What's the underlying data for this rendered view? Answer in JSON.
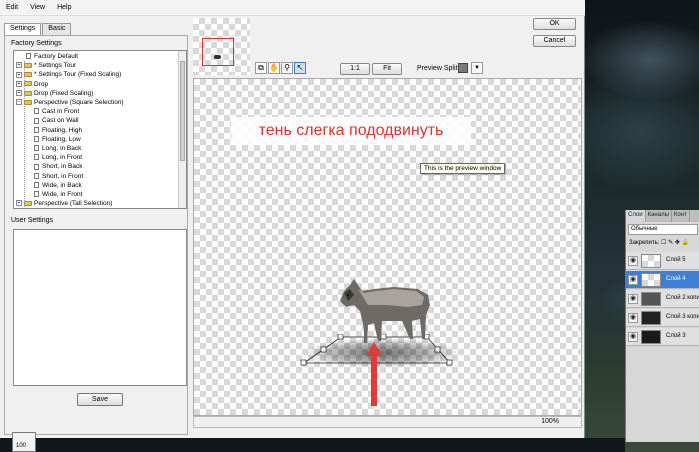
{
  "menu": [
    "Edit",
    "View",
    "Help"
  ],
  "tabs": [
    {
      "label": "Settings",
      "active": true
    },
    {
      "label": "Basic",
      "active": false
    }
  ],
  "factory_settings_label": "Factory Settings",
  "tree_items": [
    {
      "label": "Factory Default",
      "kind": "doc",
      "level": 1
    },
    {
      "label": "* Settings Tour",
      "kind": "folder",
      "level": 0,
      "expander": "+"
    },
    {
      "label": "* Settings Tour (Fixed Scaling)",
      "kind": "folder",
      "level": 0,
      "expander": "+"
    },
    {
      "label": "Drop",
      "kind": "folder",
      "level": 0,
      "expander": "+"
    },
    {
      "label": "Drop (Fixed Scaling)",
      "kind": "folder",
      "level": 0,
      "expander": "+"
    },
    {
      "label": "Perspective (Square Selection)",
      "kind": "folder",
      "level": 0,
      "expander": "−"
    },
    {
      "label": "Cast in Front",
      "kind": "doc",
      "level": 2
    },
    {
      "label": "Cast on Wall",
      "kind": "doc",
      "level": 2
    },
    {
      "label": "Floating, High",
      "kind": "doc",
      "level": 2
    },
    {
      "label": "Floating, Low",
      "kind": "doc",
      "level": 2
    },
    {
      "label": "Long, in Back",
      "kind": "doc",
      "level": 2
    },
    {
      "label": "Long, in Front",
      "kind": "doc",
      "level": 2
    },
    {
      "label": "Short, in Back",
      "kind": "doc",
      "level": 2
    },
    {
      "label": "Short, in Front",
      "kind": "doc",
      "level": 2
    },
    {
      "label": "Wide, in Back",
      "kind": "doc",
      "level": 2
    },
    {
      "label": "Wide, in Front",
      "kind": "doc",
      "level": 2
    },
    {
      "label": "Perspective (Tall Selection)",
      "kind": "folder",
      "level": 0,
      "expander": "+"
    }
  ],
  "user_settings_label": "User Settings",
  "save_label": "Save",
  "ok_label": "OK",
  "cancel_label": "Cancel",
  "toolbar_icons": [
    "copy-icon",
    "hand-icon",
    "zoom-icon",
    "pointer-icon"
  ],
  "zoom_1to1_label": "1:1",
  "fit_label": "Fit",
  "preview_split_label": "Preview Split:",
  "preview_split_color": "#7b7b7b",
  "caption_text": "тень слегка пододвинуть",
  "caption_color": "#e4322b",
  "tooltip_text": "This is the preview window",
  "zoom_percent": "100%",
  "ruler_value": "100",
  "layers_panel": {
    "tabs": [
      "Слои",
      "Каналы",
      "Конт"
    ],
    "blend_mode": "Обычные",
    "lock_label": "Закрепить:",
    "layers": [
      {
        "name": "Слой 5",
        "selected": false
      },
      {
        "name": "Слой 4",
        "selected": true
      },
      {
        "name": "Слой 2 копи",
        "selected": false
      },
      {
        "name": "Слой 3 копи",
        "selected": false
      },
      {
        "name": "Слой 3",
        "selected": false
      }
    ]
  }
}
